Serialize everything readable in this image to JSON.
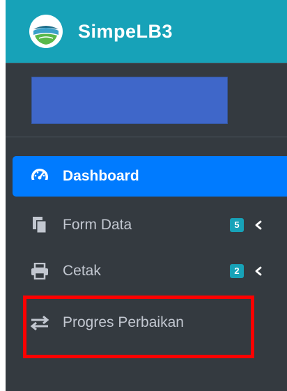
{
  "brand": {
    "title": "SimpeLB3",
    "logo_icon": "simpelb3-logo-icon"
  },
  "user": {
    "name_block_color": "#3f67c9"
  },
  "nav": {
    "items": [
      {
        "label": "Dashboard",
        "icon": "tachometer-icon",
        "active": true
      },
      {
        "label": "Form Data",
        "icon": "copy-documents-icon",
        "badge": "5",
        "has_submenu": true
      },
      {
        "label": "Cetak",
        "icon": "print-icon",
        "badge": "2",
        "has_submenu": true
      },
      {
        "label": "Progres Perbaikan",
        "icon": "exchange-arrows-icon"
      }
    ]
  },
  "colors": {
    "brand_bar": "#17a2b8",
    "sidebar_bg": "#343a40",
    "active_item": "#007bff",
    "badge": "#17a2b8",
    "highlight": "#ff0000"
  }
}
